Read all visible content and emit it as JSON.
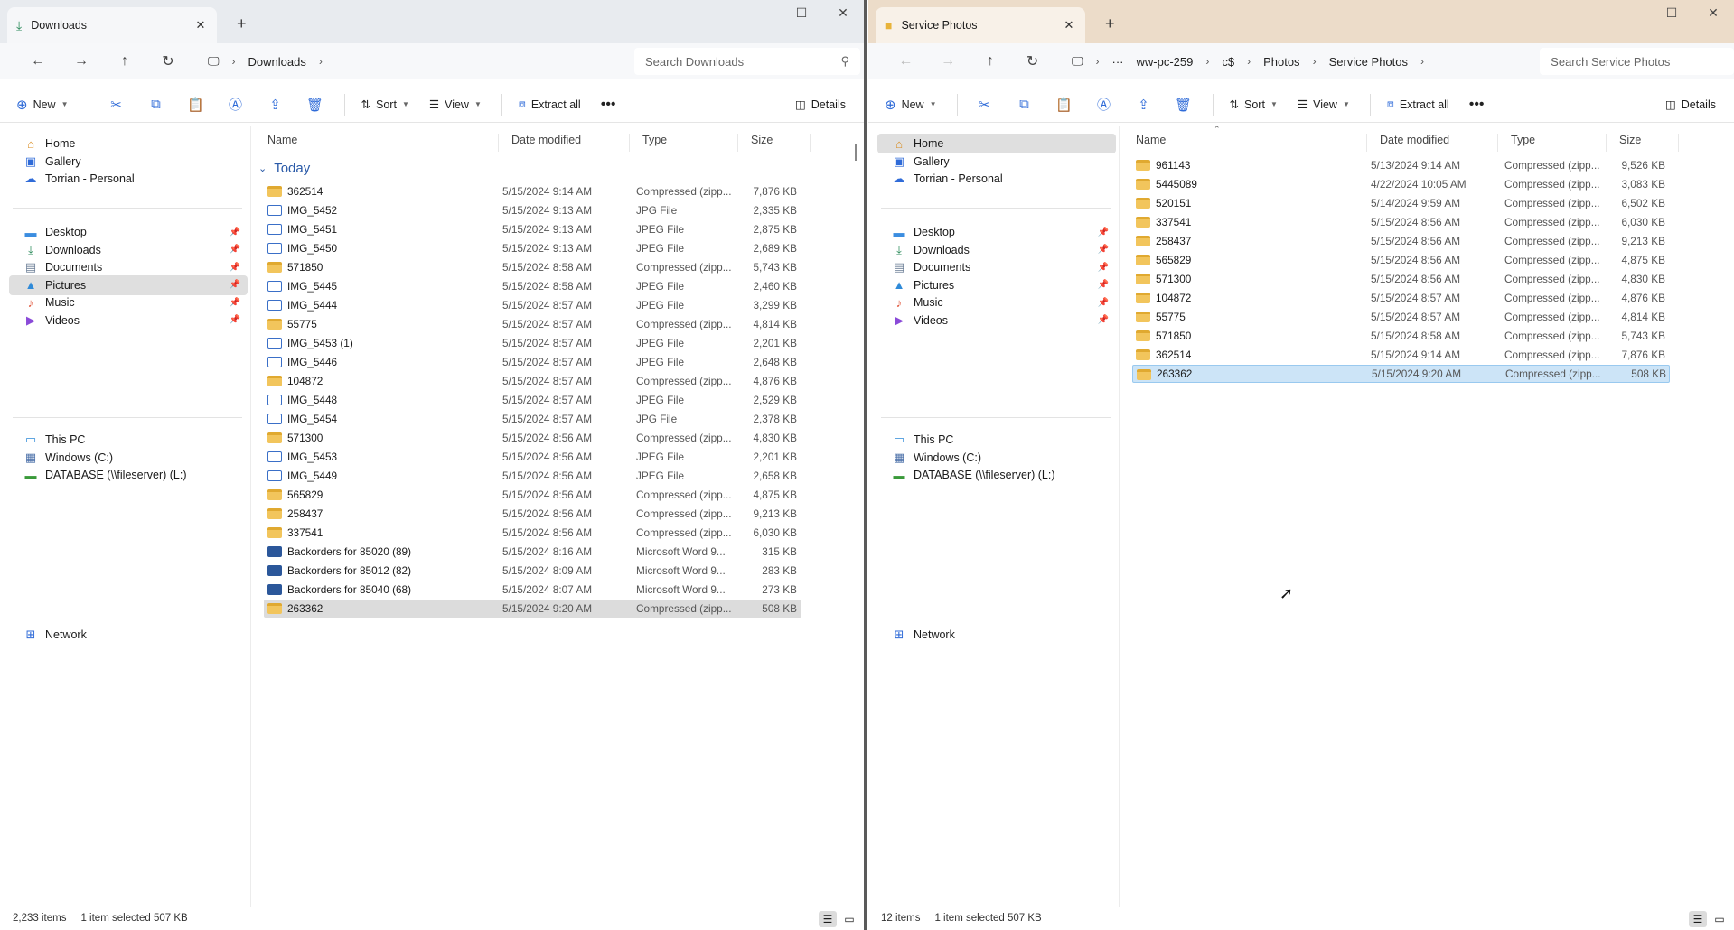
{
  "left": {
    "tab_title": "Downloads",
    "crumbs": [
      "Downloads"
    ],
    "search_placeholder": "Search Downloads",
    "commands": {
      "new": "New",
      "sort": "Sort",
      "view": "View",
      "extract": "Extract all",
      "details": "Details"
    },
    "columns": {
      "name": "Name",
      "date": "Date modified",
      "type": "Type",
      "size": "Size"
    },
    "group": "Today",
    "files": [
      {
        "name": "362514",
        "date": "5/15/2024 9:14 AM",
        "type": "Compressed (zipp...",
        "size": "7,876 KB",
        "kind": "zip"
      },
      {
        "name": "IMG_5452",
        "date": "5/15/2024 9:13 AM",
        "type": "JPG File",
        "size": "2,335 KB",
        "kind": "img"
      },
      {
        "name": "IMG_5451",
        "date": "5/15/2024 9:13 AM",
        "type": "JPEG File",
        "size": "2,875 KB",
        "kind": "img"
      },
      {
        "name": "IMG_5450",
        "date": "5/15/2024 9:13 AM",
        "type": "JPEG File",
        "size": "2,689 KB",
        "kind": "img"
      },
      {
        "name": "571850",
        "date": "5/15/2024 8:58 AM",
        "type": "Compressed (zipp...",
        "size": "5,743 KB",
        "kind": "zip"
      },
      {
        "name": "IMG_5445",
        "date": "5/15/2024 8:58 AM",
        "type": "JPEG File",
        "size": "2,460 KB",
        "kind": "img"
      },
      {
        "name": "IMG_5444",
        "date": "5/15/2024 8:57 AM",
        "type": "JPEG File",
        "size": "3,299 KB",
        "kind": "img"
      },
      {
        "name": "55775",
        "date": "5/15/2024 8:57 AM",
        "type": "Compressed (zipp...",
        "size": "4,814 KB",
        "kind": "zip"
      },
      {
        "name": "IMG_5453 (1)",
        "date": "5/15/2024 8:57 AM",
        "type": "JPEG File",
        "size": "2,201 KB",
        "kind": "img"
      },
      {
        "name": "IMG_5446",
        "date": "5/15/2024 8:57 AM",
        "type": "JPEG File",
        "size": "2,648 KB",
        "kind": "img"
      },
      {
        "name": "104872",
        "date": "5/15/2024 8:57 AM",
        "type": "Compressed (zipp...",
        "size": "4,876 KB",
        "kind": "zip"
      },
      {
        "name": "IMG_5448",
        "date": "5/15/2024 8:57 AM",
        "type": "JPEG File",
        "size": "2,529 KB",
        "kind": "img"
      },
      {
        "name": "IMG_5454",
        "date": "5/15/2024 8:57 AM",
        "type": "JPG File",
        "size": "2,378 KB",
        "kind": "img"
      },
      {
        "name": "571300",
        "date": "5/15/2024 8:56 AM",
        "type": "Compressed (zipp...",
        "size": "4,830 KB",
        "kind": "zip"
      },
      {
        "name": "IMG_5453",
        "date": "5/15/2024 8:56 AM",
        "type": "JPEG File",
        "size": "2,201 KB",
        "kind": "img"
      },
      {
        "name": "IMG_5449",
        "date": "5/15/2024 8:56 AM",
        "type": "JPEG File",
        "size": "2,658 KB",
        "kind": "img"
      },
      {
        "name": "565829",
        "date": "5/15/2024 8:56 AM",
        "type": "Compressed (zipp...",
        "size": "4,875 KB",
        "kind": "zip"
      },
      {
        "name": "258437",
        "date": "5/15/2024 8:56 AM",
        "type": "Compressed (zipp...",
        "size": "9,213 KB",
        "kind": "zip"
      },
      {
        "name": "337541",
        "date": "5/15/2024 8:56 AM",
        "type": "Compressed (zipp...",
        "size": "6,030 KB",
        "kind": "zip"
      },
      {
        "name": "Backorders for 85020 (89)",
        "date": "5/15/2024 8:16 AM",
        "type": "Microsoft Word 9...",
        "size": "315 KB",
        "kind": "doc"
      },
      {
        "name": "Backorders for 85012 (82)",
        "date": "5/15/2024 8:09 AM",
        "type": "Microsoft Word 9...",
        "size": "283 KB",
        "kind": "doc"
      },
      {
        "name": "Backorders for 85040 (68)",
        "date": "5/15/2024 8:07 AM",
        "type": "Microsoft Word 9...",
        "size": "273 KB",
        "kind": "doc"
      },
      {
        "name": "263362",
        "date": "5/15/2024 9:20 AM",
        "type": "Compressed (zipp...",
        "size": "508 KB",
        "kind": "zip",
        "selected": true
      }
    ],
    "status_items": "2,233 items",
    "status_selected": "1 item selected  507 KB"
  },
  "right": {
    "tab_title": "Service Photos",
    "crumbs": [
      "···",
      "ww-pc-259",
      "c$",
      "Photos",
      "Service Photos"
    ],
    "search_placeholder": "Search Service Photos",
    "commands": {
      "new": "New",
      "sort": "Sort",
      "view": "View",
      "extract": "Extract all",
      "details": "Details"
    },
    "columns": {
      "name": "Name",
      "date": "Date modified",
      "type": "Type",
      "size": "Size"
    },
    "files": [
      {
        "name": "961143",
        "date": "5/13/2024 9:14 AM",
        "type": "Compressed (zipp...",
        "size": "9,526 KB",
        "kind": "zip"
      },
      {
        "name": "5445089",
        "date": "4/22/2024 10:05 AM",
        "type": "Compressed (zipp...",
        "size": "3,083 KB",
        "kind": "zip"
      },
      {
        "name": "520151",
        "date": "5/14/2024 9:59 AM",
        "type": "Compressed (zipp...",
        "size": "6,502 KB",
        "kind": "zip"
      },
      {
        "name": "337541",
        "date": "5/15/2024 8:56 AM",
        "type": "Compressed (zipp...",
        "size": "6,030 KB",
        "kind": "zip"
      },
      {
        "name": "258437",
        "date": "5/15/2024 8:56 AM",
        "type": "Compressed (zipp...",
        "size": "9,213 KB",
        "kind": "zip"
      },
      {
        "name": "565829",
        "date": "5/15/2024 8:56 AM",
        "type": "Compressed (zipp...",
        "size": "4,875 KB",
        "kind": "zip"
      },
      {
        "name": "571300",
        "date": "5/15/2024 8:56 AM",
        "type": "Compressed (zipp...",
        "size": "4,830 KB",
        "kind": "zip"
      },
      {
        "name": "104872",
        "date": "5/15/2024 8:57 AM",
        "type": "Compressed (zipp...",
        "size": "4,876 KB",
        "kind": "zip"
      },
      {
        "name": "55775",
        "date": "5/15/2024 8:57 AM",
        "type": "Compressed (zipp...",
        "size": "4,814 KB",
        "kind": "zip"
      },
      {
        "name": "571850",
        "date": "5/15/2024 8:58 AM",
        "type": "Compressed (zipp...",
        "size": "5,743 KB",
        "kind": "zip"
      },
      {
        "name": "362514",
        "date": "5/15/2024 9:14 AM",
        "type": "Compressed (zipp...",
        "size": "7,876 KB",
        "kind": "zip"
      },
      {
        "name": "263362",
        "date": "5/15/2024 9:20 AM",
        "type": "Compressed (zipp...",
        "size": "508 KB",
        "kind": "zip",
        "selected": true
      }
    ],
    "status_items": "12 items",
    "status_selected": "1 item selected  507 KB"
  },
  "nav": {
    "quick": [
      {
        "label": "Home",
        "icon": "home-icon"
      },
      {
        "label": "Gallery",
        "icon": "gallery-icon"
      },
      {
        "label": "Torrian - Personal",
        "icon": "cloud-icon"
      }
    ],
    "pinned": [
      {
        "label": "Desktop",
        "icon": "desktop-icon"
      },
      {
        "label": "Downloads",
        "icon": "download-icon"
      },
      {
        "label": "Documents",
        "icon": "documents-icon"
      },
      {
        "label": "Pictures",
        "icon": "pictures-icon"
      },
      {
        "label": "Music",
        "icon": "music-icon"
      },
      {
        "label": "Videos",
        "icon": "videos-icon"
      }
    ],
    "pc": [
      {
        "label": "This PC",
        "icon": "pc-icon"
      },
      {
        "label": "Windows (C:)",
        "icon": "drive-icon"
      },
      {
        "label": "DATABASE (\\\\fileserver) (L:)",
        "icon": "network-drive-icon"
      }
    ],
    "network": "Network"
  },
  "colors": {
    "accent": "#2f6bd8",
    "left_titlebar": "#e8ebef",
    "right_titlebar": "#ecdcc9",
    "selection_right": "#cce4f7"
  }
}
